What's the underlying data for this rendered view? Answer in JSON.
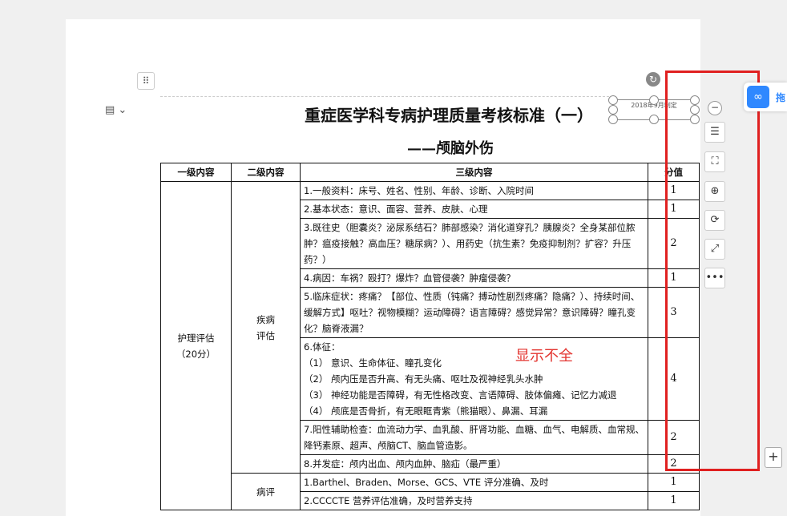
{
  "document": {
    "title": "重症医学科专病护理质量考核标准（一）",
    "subtitle": "——颅脑外伤",
    "textbox": "2018年9月制定",
    "annotation": "显示不全",
    "table": {
      "headers": [
        "一级内容",
        "二级内容",
        "三级内容",
        "分值"
      ],
      "level1": "护理评估\n（20分）",
      "level2_a": "疾病\n评估",
      "level2_b": "病评",
      "rows": [
        {
          "text": "1.一般资料：床号、姓名、性别、年龄、诊断、入院时间",
          "score": "1"
        },
        {
          "text": "2.基本状态：意识、面容、营养、皮肤、心理",
          "score": "1"
        },
        {
          "text": "3.既往史（胆囊炎？泌尿系结石？肺部感染？消化道穿孔？胰腺炎？全身某部位脓肿？瘟疫接触？高血压？糖尿病？）、用药史（抗生素？免疫抑制剂？扩容？升压药？）",
          "score": "2"
        },
        {
          "text": "4.病因：车祸？殴打？爆炸？血管侵袭？肿瘤侵袭？",
          "score": "1"
        },
        {
          "text": "5.临床症状：疼痛？【部位、性质（钝痛？搏动性剧烈疼痛？隐痛？）、持续时间、缓解方式】呕吐？视物模糊？运动障碍？语言障碍？感觉异常？意识障碍？瞳孔变化？脑脊液漏？",
          "score": "3"
        },
        {
          "text": "6.体征：\n（1） 意识、生命体征、瞳孔变化\n（2） 颅内压是否升高、有无头痛、呕吐及视神经乳头水肿\n（3） 神经功能是否障碍，有无性格改变、言语障碍、肢体偏瘫、记忆力减退\n（4） 颅底是否骨折，有无眼眶青紫（熊猫眼）、鼻漏、耳漏",
          "score": "4"
        },
        {
          "text": "7.阳性辅助检查：血流动力学、血乳酸、肝肾功能、血糖、血气、电解质、血常规、降钙素原、超声、颅脑CT、脑血管造影。",
          "score": "2"
        },
        {
          "text": "8.并发症：颅内出血、颅内血肿、脑疝（最严重）",
          "score": "2"
        },
        {
          "text": "1.Barthel、Braden、Morse、GCS、VTE 评分准确、及时",
          "score": "1"
        },
        {
          "text": "2.CCCCTE 营养评估准确，及时营养支持",
          "score": "1"
        }
      ]
    }
  },
  "toolbar": {
    "items": [
      "collapse-icon",
      "wrap-text-icon",
      "crop-icon",
      "zoom-in-icon",
      "rotate-icon",
      "fit-icon",
      "more-icon"
    ],
    "more_label": "•••",
    "minus_label": "−",
    "plus_label": "+"
  },
  "side_app": {
    "label": "拖"
  },
  "colors": {
    "highlight": "#e02020",
    "brand": "#2f88ff"
  }
}
